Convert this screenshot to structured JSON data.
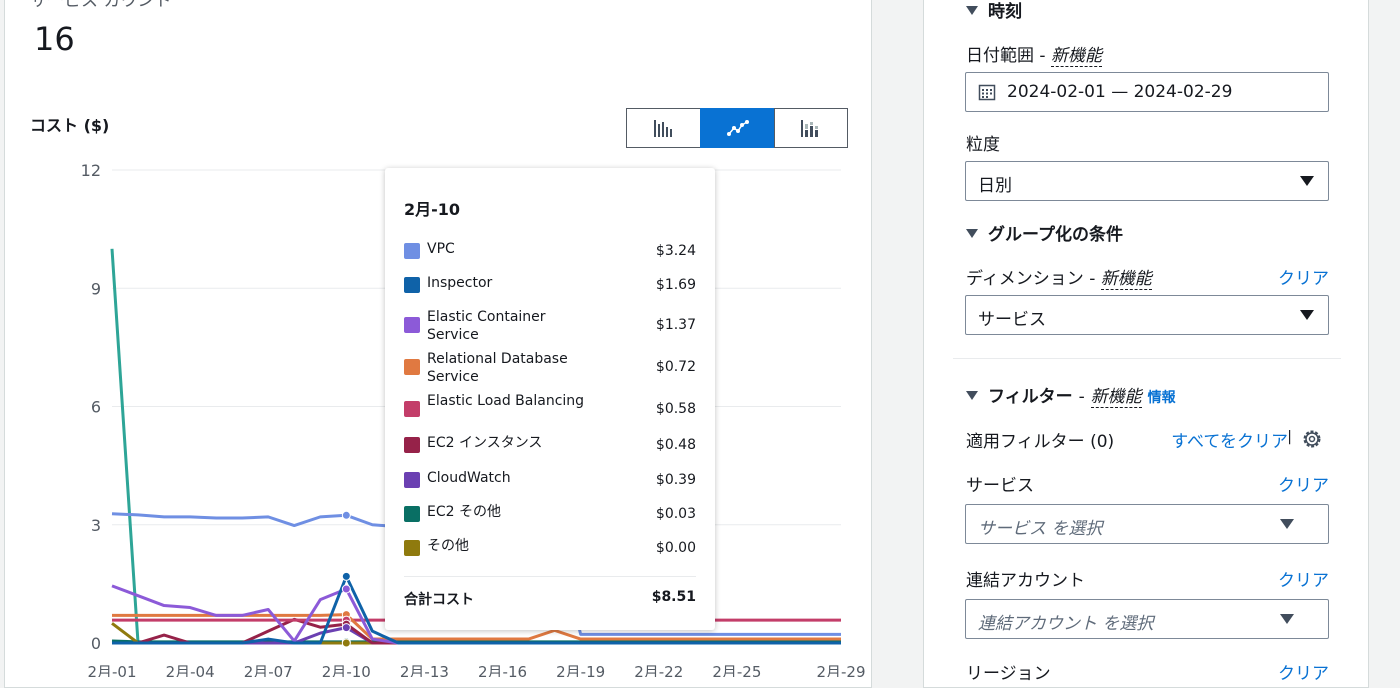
{
  "summary": {
    "service_count_label": "サービス カウント",
    "service_count": "16"
  },
  "chart_header": {
    "title": "コスト ($)"
  },
  "view_toggle": {
    "options": [
      "bar-chart-icon",
      "line-chart-icon",
      "stacked-bar-chart-icon"
    ],
    "selected": "line-chart-icon",
    "accent": "#0972d3"
  },
  "chart_data": {
    "type": "line",
    "ylim": [
      0,
      12
    ],
    "yticks": [
      "0",
      "3",
      "6",
      "9",
      "12"
    ],
    "x": [
      "2月-01",
      "2月-02",
      "2月-03",
      "2月-04",
      "2月-05",
      "2月-06",
      "2月-07",
      "2月-08",
      "2月-09",
      "2月-10",
      "2月-11",
      "2月-12",
      "2月-13",
      "2月-14",
      "2月-15",
      "2月-16",
      "2月-17",
      "2月-18",
      "2月-19",
      "2月-20",
      "2月-21",
      "2月-22",
      "2月-23",
      "2月-24",
      "2月-25",
      "2月-26",
      "2月-27",
      "2月-28",
      "2月-29"
    ],
    "xticks": [
      "2月-01",
      "2月-04",
      "2月-07",
      "2月-10",
      "2月-13",
      "2月-16",
      "2月-19",
      "2月-22",
      "2月-25",
      "2月-29"
    ],
    "grid": true,
    "series": [
      {
        "name": "VPC",
        "color": "#6f8fe3",
        "values": [
          3.28,
          3.25,
          3.2,
          3.2,
          3.17,
          3.17,
          3.2,
          2.98,
          3.2,
          3.24,
          3.0,
          2.95,
          2.9,
          2.9,
          2.9,
          2.9,
          2.9,
          2.9,
          0.22,
          0.22,
          0.22,
          0.22,
          0.22,
          0.22,
          0.22,
          0.22,
          0.22,
          0.22,
          0.22
        ]
      },
      {
        "name": "Inspector",
        "color": "#0f62a8",
        "values": [
          0,
          0,
          0,
          0,
          0,
          0,
          0.1,
          0,
          0,
          1.69,
          0.3,
          0,
          0,
          0,
          0,
          0,
          0,
          0,
          0,
          0,
          0,
          0,
          0,
          0,
          0,
          0,
          0,
          0,
          0
        ]
      },
      {
        "name": "Elastic Container Service",
        "color": "#8c5ad8",
        "values": [
          1.45,
          1.2,
          0.95,
          0.9,
          0.7,
          0.7,
          0.85,
          0.05,
          1.1,
          1.37,
          0.1,
          0,
          0,
          0,
          0,
          0,
          0,
          0,
          0,
          0,
          0,
          0,
          0,
          0,
          0,
          0,
          0,
          0,
          0
        ]
      },
      {
        "name": "Relational Database Service",
        "color": "#e07941",
        "values": [
          0.7,
          0.7,
          0.7,
          0.7,
          0.7,
          0.7,
          0.7,
          0.7,
          0.7,
          0.72,
          0.1,
          0.1,
          0.1,
          0.1,
          0.1,
          0.1,
          0.1,
          0.32,
          0.1,
          0.1,
          0.1,
          0.1,
          0.1,
          0.1,
          0.1,
          0.1,
          0.1,
          0.1,
          0.1
        ]
      },
      {
        "name": "Elastic Load Balancing",
        "color": "#c33d69",
        "values": [
          0.58,
          0.58,
          0.58,
          0.58,
          0.58,
          0.58,
          0.58,
          0.58,
          0.58,
          0.58,
          0.58,
          0.58,
          0.58,
          0.58,
          0.58,
          0.58,
          0.58,
          0.58,
          0.58,
          0.58,
          0.58,
          0.58,
          0.58,
          0.58,
          0.58,
          0.58,
          0.58,
          0.58,
          0.58
        ]
      },
      {
        "name": "EC2 インスタンス",
        "color": "#962249",
        "values": [
          0,
          0,
          0.2,
          0,
          0,
          0,
          0.3,
          0.6,
          0.4,
          0.48,
          0,
          0,
          0,
          0,
          0,
          0,
          0,
          0,
          0,
          0,
          0,
          0,
          0,
          0,
          0,
          0,
          0,
          0,
          0
        ]
      },
      {
        "name": "CloudWatch",
        "color": "#6b40b2",
        "values": [
          0,
          0,
          0,
          0,
          0,
          0,
          0,
          0,
          0.25,
          0.39,
          0,
          0,
          0,
          0,
          0,
          0,
          0,
          0,
          0,
          0,
          0,
          0,
          0,
          0,
          0,
          0,
          0,
          0,
          0
        ]
      },
      {
        "name": "EC2 その他",
        "color": "#096f64",
        "values": [
          0.05,
          0.03,
          0.03,
          0.03,
          0.03,
          0.03,
          0.03,
          0.03,
          0.03,
          0.03,
          0.03,
          0.03,
          0.03,
          0.03,
          0.03,
          0.03,
          0.03,
          0.03,
          0.03,
          0.03,
          0.03,
          0.03,
          0.03,
          0.03,
          0.03,
          0.03,
          0.03,
          0.03,
          0.03
        ]
      },
      {
        "name": "その他",
        "color": "#8f7a0e",
        "values": [
          0.5,
          0,
          0,
          0,
          0,
          0,
          0,
          0,
          0,
          0,
          0,
          0,
          0,
          0,
          0,
          0,
          0,
          0,
          0,
          0,
          0,
          0,
          0,
          0,
          0,
          0,
          0,
          0,
          0
        ]
      },
      {
        "name": "",
        "color": "#2ea597",
        "values": [
          10,
          0,
          0,
          0,
          0,
          0,
          0,
          0,
          0,
          0,
          0,
          0,
          0,
          0,
          0,
          0,
          0,
          0,
          0,
          0,
          0,
          0,
          0,
          0,
          0,
          0,
          0,
          0,
          0
        ]
      }
    ]
  },
  "tooltip": {
    "date": "2月-10",
    "rows": [
      {
        "label": "VPC",
        "value": "$3.24",
        "color": "#6f8fe3"
      },
      {
        "label": "Inspector",
        "value": "$1.69",
        "color": "#0f62a8"
      },
      {
        "label": "Elastic Container Service",
        "value": "$1.37",
        "color": "#8c5ad8"
      },
      {
        "label": "Relational Database Service",
        "value": "$0.72",
        "color": "#e07941"
      },
      {
        "label": "Elastic Load Balancing",
        "value": "$0.58",
        "color": "#c33d69"
      },
      {
        "label": "EC2 インスタンス",
        "value": "$0.48",
        "color": "#962249"
      },
      {
        "label": "CloudWatch",
        "value": "$0.39",
        "color": "#6b40b2"
      },
      {
        "label": "EC2 その他",
        "value": "$0.03",
        "color": "#096f64"
      },
      {
        "label": "その他",
        "value": "$0.00",
        "color": "#8f7a0e"
      }
    ],
    "total_label": "合計コスト",
    "total_value": "$8.51"
  },
  "filters": {
    "time_header": "時刻",
    "date_range_label": "日付範囲",
    "new_feature": "新機能",
    "date_range_value": "2024-02-01 — 2024-02-29",
    "granularity_label": "粒度",
    "granularity_value": "日別",
    "group_header": "グループ化の条件",
    "dimension_label": "ディメンション",
    "clear": "クリア",
    "dimension_value": "サービス",
    "filter_header": "フィルター",
    "info": "情報",
    "applied_filters": "適用フィルター (0)",
    "clear_all": "すべてをクリア",
    "service_label": "サービス",
    "service_placeholder": "サービス を選択",
    "linked_account_label": "連結アカウント",
    "linked_account_placeholder": "連結アカウント を選択",
    "region_label": "リージョン"
  }
}
